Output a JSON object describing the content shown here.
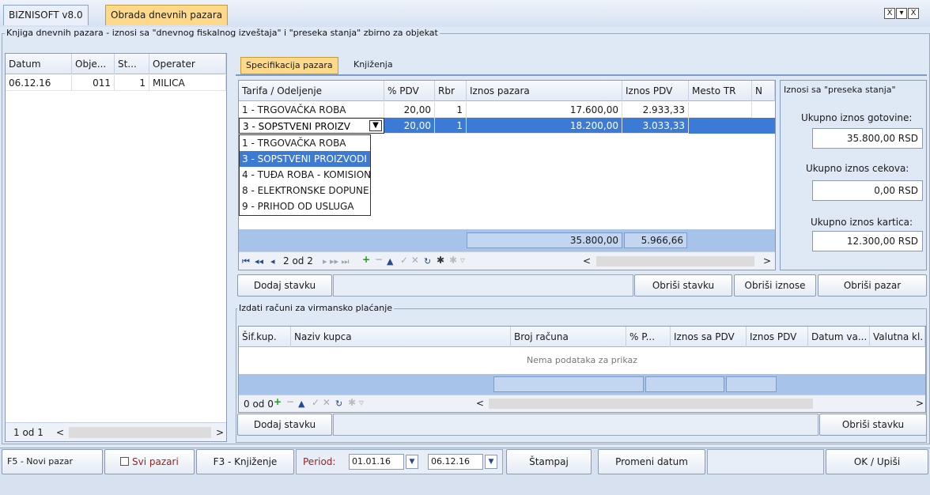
{
  "app": {
    "name": "BIZNISOFT v8.0",
    "tab": "Obrada dnevnih pazara",
    "win_buttons": [
      "X",
      "▾",
      "X"
    ]
  },
  "main_group": {
    "title": "Knjiga dnevnih pazara - iznosi sa \"dnevnog fiskalnog izveštaja\" i \"preseka stanja\" zbirno za objekat"
  },
  "left_grid": {
    "columns": [
      "Datum",
      "Obje...",
      "St...",
      "Operater"
    ],
    "rows": [
      {
        "datum": "06.12.16",
        "objekat": "011",
        "st": "1",
        "operater": "MILICA"
      }
    ],
    "pager": "1 od 1",
    "scroll_left": "<",
    "scroll_right": ">"
  },
  "inner_tabs": [
    "Specifikacija pazara",
    "Knjiženja"
  ],
  "spec_grid": {
    "columns": [
      "Tarifa / Odeljenje",
      "% PDV",
      "Rbr",
      "Iznos pazara",
      "Iznos PDV",
      "Mesto TR",
      "N"
    ],
    "rows": [
      {
        "tarifa": "1 - TRGOVAČKA ROBA",
        "pdv": "20,00",
        "rbr": "1",
        "iznos": "17.600,00",
        "iznos_pdv": "2.933,33"
      },
      {
        "tarifa": "3 - SOPSTVENI PROIZV",
        "pdv": "20,00",
        "rbr": "1",
        "iznos": "18.200,00",
        "iznos_pdv": "3.033,33"
      }
    ],
    "dropdown_options": [
      "1 - TRGOVAČKA ROBA",
      "3 - SOPSTVENI PROIZVODI",
      "4 - TUĐA ROBA - KOMISION",
      "8 - ELEKTRONSKE DOPUNE",
      "9 - PRIHOD OD USLUGA"
    ],
    "totals": {
      "iznos": "35.800,00",
      "pdv": "5.966,66"
    },
    "pager": "2 od 2",
    "scroll_left": "<",
    "scroll_right": ">"
  },
  "preseka": {
    "title": "Iznosi sa \"preseka stanja\"",
    "gotovina_label": "Ukupno iznos gotovine:",
    "gotovina": "35.800,00 RSD",
    "cekovi_label": "Ukupno iznos cekova:",
    "cekovi": "0,00 RSD",
    "kartice_label": "Ukupno iznos kartica:",
    "kartice": "12.300,00 RSD"
  },
  "spec_buttons": {
    "dodaj": "Dodaj stavku",
    "obrisi_stavku": "Obriši stavku",
    "obrisi_iznose": "Obriši iznose",
    "obrisi_pazar": "Obriši pazar"
  },
  "virman": {
    "title": "Izdati računi za virmansko plaćanje",
    "columns": [
      "Šif.kup.",
      "Naziv kupca",
      "Broj računa",
      "% P...",
      "Iznos sa PDV",
      "Iznos PDV",
      "Datum va...",
      "Valutna kl."
    ],
    "empty": "Nema podataka za prikaz",
    "pager": "0 od 0",
    "scroll_left": "<",
    "scroll_right": ">",
    "dodaj": "Dodaj stavku",
    "obrisi": "Obriši stavku"
  },
  "bottom": {
    "f5": "F5 - Novi pazar",
    "svi": "Svi pazari",
    "f3": "F3 - Knjiženje",
    "period_label": "Period:",
    "date_from": "01.01.16",
    "date_to": "06.12.16",
    "stampaj": "Štampaj",
    "promeni": "Promeni datum",
    "ok": "OK / Upiši"
  },
  "colors": {
    "selection": "#3b7bd6",
    "accent_tab": "#ffd98a",
    "total_band": "#a8c3ea"
  }
}
